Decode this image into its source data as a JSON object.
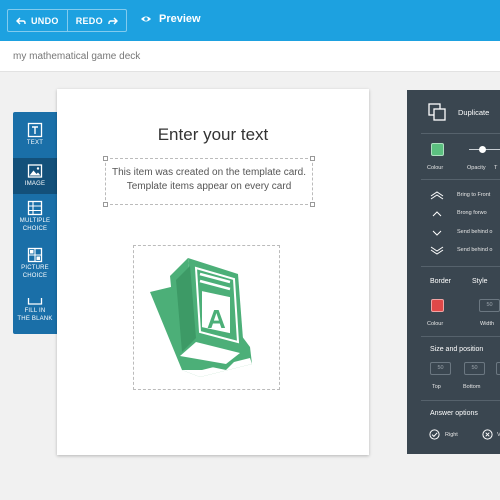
{
  "toolbar": {
    "undo_label": "UNDO",
    "redo_label": "REDO",
    "preview_label": "Preview",
    "undo_icon": "undo-arrow-icon",
    "redo_icon": "redo-arrow-icon",
    "preview_icon": "eye-icon",
    "bg_color": "#1da1e0"
  },
  "deck": {
    "name": "my mathematical game deck"
  },
  "palette": {
    "items": [
      {
        "label": "TEXT",
        "icon": "text-icon"
      },
      {
        "label": "IMAGE",
        "icon": "image-icon",
        "active": true
      },
      {
        "label": "MULTIPLE CHOICE",
        "line1": "MULTIPLE",
        "line2": "CHOICE",
        "icon": "grid-icon"
      },
      {
        "label": "PICTURE CHOICE",
        "line1": "PICTURE",
        "line2": "CHOICE",
        "icon": "picture-grid-icon"
      },
      {
        "label": "FILL IN THE BLANK",
        "line1": "FILL IN",
        "line2": "THE BLANK",
        "icon": "blank-line-icon"
      }
    ]
  },
  "card": {
    "title": "Enter your text",
    "template_text_line1": "This item was created on the template card.",
    "template_text_line2": "Template items appear on every card",
    "image_icon": "book-letter-a-icon",
    "image_color": "#4caf78"
  },
  "panel": {
    "duplicate_label": "Duplicate",
    "colour_label": "Colour",
    "opacity_label": "Opacity",
    "opacity_cut": "T",
    "fill_color": "#5cc080",
    "order_items": [
      "Bring to Front",
      "Brong forwo",
      "Send behind o",
      "Send behind o"
    ],
    "border_label": "Border",
    "style_label": "Style",
    "style_value": "50",
    "border_colour_label": "Colour",
    "width_label": "Width",
    "border_color": "#e04848",
    "size_position_label": "Size and position",
    "top_value": "50",
    "bottom_value": "50",
    "top_label": "Top",
    "bottom_label": "Bottom",
    "answer_options_label": "Answer options",
    "right_label": "Right",
    "wrong_label_cut": "V",
    "bg_color": "#3a4650"
  }
}
